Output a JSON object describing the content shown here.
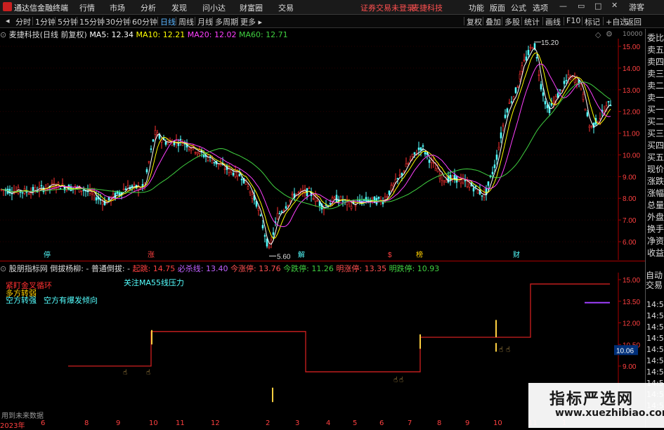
{
  "app": {
    "title": "通达信金融终端"
  },
  "menu": [
    "行情",
    "市场",
    "分析",
    "发现",
    "问小达",
    "财富圈",
    "交易"
  ],
  "status": {
    "login": "证券交易未登录",
    "stock_link": "麦捷科技"
  },
  "right_menu": [
    "功能",
    "版面",
    "公式",
    "选项"
  ],
  "guest": "游客",
  "periods": [
    "分时",
    "1分钟",
    "5分钟",
    "15分钟",
    "30分钟",
    "60分钟",
    "日线",
    "周线",
    "月线",
    "多周期",
    "更多"
  ],
  "active_period": "日线",
  "tools": [
    "复权",
    "叠加",
    "多股",
    "统计",
    "画线",
    "F10",
    "标记",
    "+自选",
    "返回"
  ],
  "main_info": {
    "stock": "麦捷科技(日线 前复权)",
    "ma5": "MA5: 12.34",
    "ma10": "MA10: 12.21",
    "ma20": "MA20: 12.02",
    "ma60": "MA60: 12.71"
  },
  "ind_info": {
    "name": "股朋指标网 倒拔杨柳: - 普通倒拔: -",
    "qidiao": "起跳: 14.75",
    "bisha": "必杀线: 13.40",
    "jinzhang": "今涨停: 13.76",
    "jindie": "今跌停: 11.26",
    "mingzhang": "明涨停: 13.35",
    "mingdie": "明跌停: 10.93"
  },
  "ind_notes": {
    "n1": "紧盯金叉循环",
    "n2": "多方转弱",
    "n3": "空方转强",
    "n4": "空方有爆发倾向",
    "n5": "关注MA55线压力"
  },
  "markers": {
    "high": "15.20",
    "low": "5.60",
    "current": "10.06"
  },
  "price_axis": [
    "15.00",
    "14.00",
    "13.00",
    "12.00",
    "11.00",
    "10.00",
    "9.00",
    "8.00",
    "7.00",
    "6.00"
  ],
  "ind_axis": [
    "15.00",
    "13.50",
    "12.00",
    "10.50",
    "9.00"
  ],
  "event_tags": [
    "停",
    "涨",
    "解",
    "$",
    "榜",
    "财"
  ],
  "right_panel": [
    "委比",
    "卖五",
    "卖四",
    "卖三",
    "卖二",
    "卖一",
    "买一",
    "买二",
    "买三",
    "买四",
    "买五",
    "现价",
    "涨跌",
    "涨幅",
    "总量",
    "外盘",
    "换手",
    "净资",
    "收益"
  ],
  "right_panel_top_num": "10000",
  "autotrade": "自动交易",
  "right_times": [
    "14:56",
    "14:56",
    "14:56",
    "14:56",
    "14:56",
    "14:56",
    "14:56",
    "14:56",
    "14:56",
    "14:56"
  ],
  "bottom_note": "用到未来数据",
  "x_labels": [
    "2023年",
    "6",
    "8",
    "9",
    "10",
    "11",
    "12",
    "2",
    "3",
    "4",
    "5",
    "6",
    "7",
    "8",
    "9",
    "10",
    "11",
    "1"
  ],
  "watermark": {
    "title": "指标严选网",
    "url": "www.xuezhibiao.com"
  },
  "colors": {
    "up": "#ff3232",
    "down": "#54ffff",
    "ma5": "#ffffff",
    "ma10": "#ffff00",
    "ma20": "#ff40ff",
    "ma60": "#40d040",
    "step": "#d02020"
  }
}
